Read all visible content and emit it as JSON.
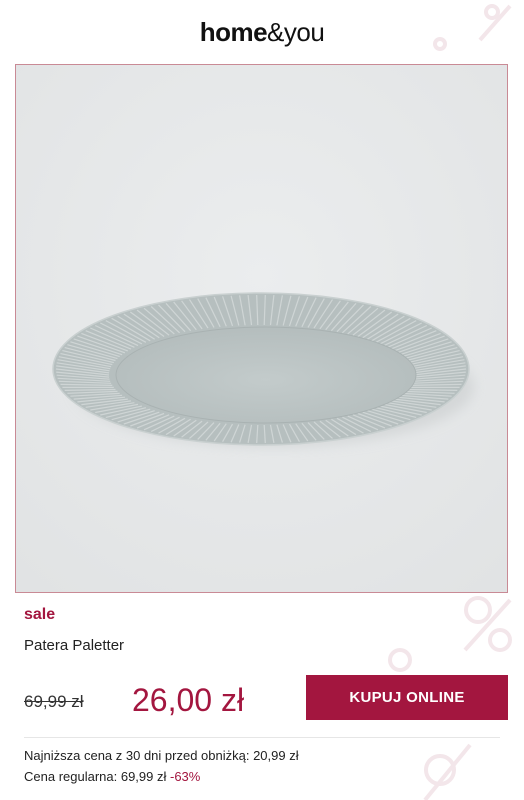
{
  "brand": {
    "logo_bold": "home",
    "logo_light": "&you"
  },
  "product": {
    "badge": "sale",
    "name": "Patera Paletter",
    "old_price": "69,99 zł",
    "new_price": "26,00 zł",
    "buy_label": "KUPUJ ONLINE",
    "lowest_price_text": "Najniższa cena z 30 dni przed obniżką: 20,99 zł",
    "regular_price_text": "Cena regularna: 69,99 zł",
    "discount": "-63%"
  },
  "colors": {
    "accent": "#a3163f",
    "image_background": "#e7e9ea",
    "plate": "#b9c2c2"
  },
  "icons": {
    "image": "plate-photo"
  }
}
